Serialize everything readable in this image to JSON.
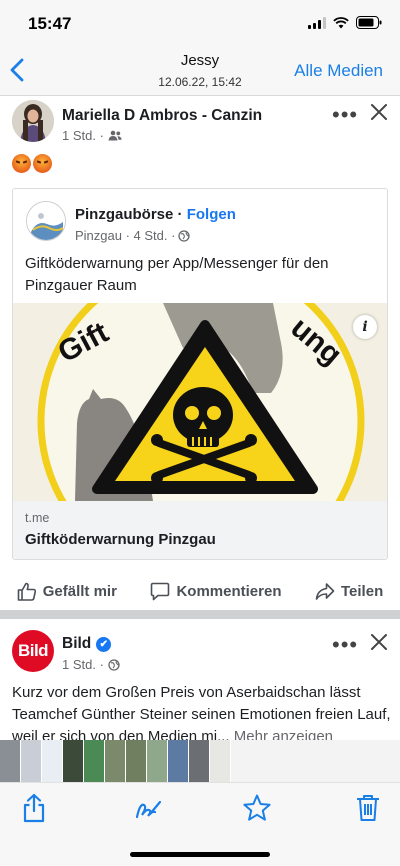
{
  "status_bar": {
    "time": "15:47"
  },
  "header": {
    "title": "Jessy",
    "subtitle": "12.06.22, 15:42",
    "right_link": "Alle Medien"
  },
  "post1": {
    "author": "Mariella D Ambros - Canzin",
    "time": "1 Std. ·",
    "audience_icon": "friends-icon",
    "reaction_emojis": [
      "angry-face",
      "angry-face"
    ],
    "shared": {
      "page_name": "Pinzgaubörse",
      "dot": " · ",
      "follow": "Folgen",
      "meta": "Pinzgau · 4 Std. ·",
      "text": "Giftköderwarnung per App/Messenger für den Pinzgauer Raum",
      "image_arc_left": "Gift",
      "image_arc_right": "ung",
      "info": "i",
      "link_domain": "t.me",
      "link_title": "Giftköderwarnung Pinzgau"
    },
    "actions": {
      "like": "Gefällt mir",
      "comment": "Kommentieren",
      "share": "Teilen"
    }
  },
  "post2": {
    "logo": "Bild",
    "author": "Bild",
    "verified_mark": "✔",
    "time": "1 Std. ·",
    "text": "Kurz vor dem Großen Preis von Aserbaidschan lässt Teamchef Günther Steiner seinen Emotionen freien Lauf, weil er sich von den Medien mi...",
    "more": " Mehr anzeigen"
  },
  "thumbnails": {
    "colors": [
      "#8a8f96",
      "#c9ced6",
      "#e9eef5",
      "#3c4a3a",
      "#4c8a55",
      "#7b8a6b",
      "#6f7f5f",
      "#8fa88c",
      "#5d7aa3",
      "#6b6f73",
      "#e7e7e3"
    ]
  },
  "colors": {
    "accent": "#1a7fe6",
    "facebook_blue": "#1877f2",
    "bild_red": "#df0b25",
    "warning_yellow": "#f7d31a"
  }
}
